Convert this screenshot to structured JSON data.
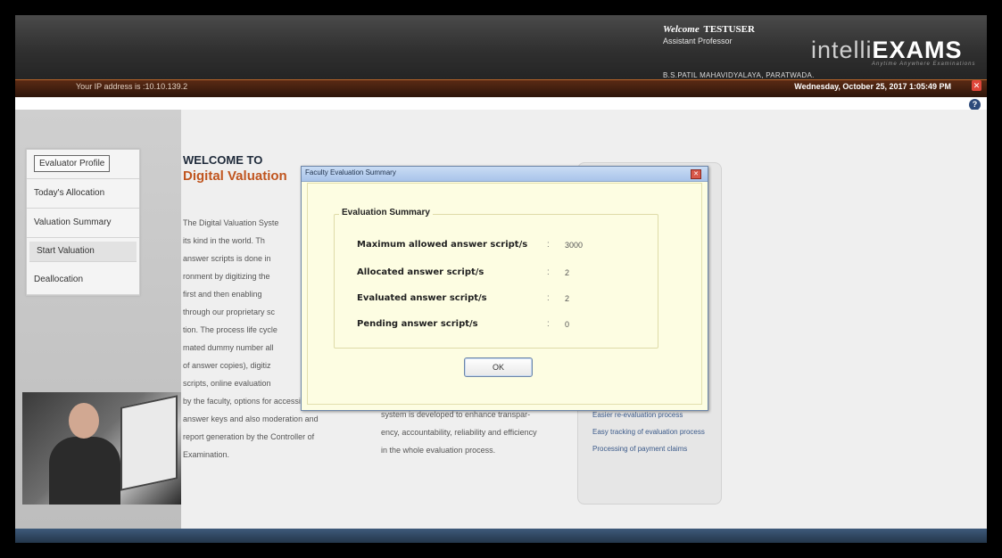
{
  "header": {
    "ip_text": "Your IP address is :10.10.139.2",
    "welcome_label": "Welcome",
    "username": "TESTUSER",
    "role": "Assistant Professor",
    "college": "B.S.PATIL MAHAVIDYALAYA, PARATWADA.",
    "datetime": "Wednesday, October 25, 2017 1:05:49 PM",
    "logo_part1": "intelli",
    "logo_part2": "EXAMS",
    "logo_tagline": "Anytime Anywhere Examinations"
  },
  "sidebar": {
    "items": [
      {
        "label": "Evaluator Profile"
      },
      {
        "label": "Today's Allocation"
      },
      {
        "label": "Valuation Summary"
      },
      {
        "label": "Start Valuation"
      },
      {
        "label": "Deallocation"
      }
    ]
  },
  "main": {
    "welcome": "WELCOME TO",
    "title": "Digital Valuation",
    "col1_lines": [
      "The Digital Valuation Syste",
      "its kind in the world. Th",
      "answer scripts is done in",
      "ronment by digitizing the",
      "first and then enabling",
      "through our proprietary sc",
      "tion. The process life cycle",
      "mated dummy number all",
      "of answer copies), digitiz",
      "scripts, online evaluation",
      "by the faculty, options for accessing",
      "answer keys and also moderation and",
      "report generation by the Controller of",
      "Examination."
    ],
    "col2_lines": [
      "system is developed to enhance transpar-",
      "ency, accountability, reliability and efficiency",
      "in the whole evaluation process."
    ],
    "features": [
      "Easier re-evaluation process",
      "Easy tracking of evaluation process",
      "Processing of payment claims"
    ]
  },
  "dialog": {
    "title": "Faculty Evaluation Summary",
    "legend": "Evaluation Summary",
    "rows": [
      {
        "label": "Maximum allowed answer script/s",
        "value": "3000"
      },
      {
        "label": "Allocated answer script/s",
        "value": "2"
      },
      {
        "label": "Evaluated answer script/s",
        "value": "2"
      },
      {
        "label": "Pending answer script/s",
        "value": "0"
      }
    ],
    "separator": ":",
    "ok_label": "OK"
  }
}
